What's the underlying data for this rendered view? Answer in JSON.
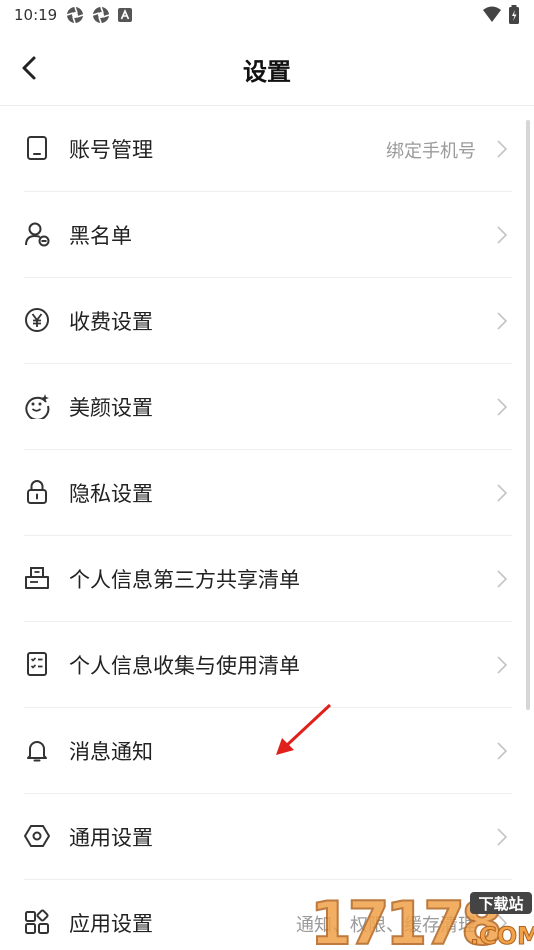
{
  "status_bar": {
    "time": "10:19",
    "icons": [
      "aperture-icon",
      "aperture-icon",
      "a-box-icon"
    ],
    "right_icons": [
      "wifi-icon",
      "battery-charging-icon"
    ]
  },
  "header": {
    "title": "设置",
    "back_icon": "chevron-left-icon"
  },
  "items": [
    {
      "label": "账号管理",
      "value": "绑定手机号",
      "icon": "phone-icon"
    },
    {
      "label": "黑名单",
      "value": "",
      "icon": "user-block-icon"
    },
    {
      "label": "收费设置",
      "value": "",
      "icon": "yen-icon"
    },
    {
      "label": "美颜设置",
      "value": "",
      "icon": "face-sparkle-icon"
    },
    {
      "label": "隐私设置",
      "value": "",
      "icon": "lock-icon"
    },
    {
      "label": "个人信息第三方共享清单",
      "value": "",
      "icon": "share-doc-icon"
    },
    {
      "label": "个人信息收集与使用清单",
      "value": "",
      "icon": "checklist-icon"
    },
    {
      "label": "消息通知",
      "value": "",
      "icon": "bell-icon"
    },
    {
      "label": "通用设置",
      "value": "",
      "icon": "hexagon-gear-icon"
    },
    {
      "label": "应用设置",
      "value": "通知、权限、缓存清理",
      "icon": "apps-grid-icon"
    }
  ],
  "colors": {
    "annotation_arrow": "#e0211b",
    "divider": "#eeeeee",
    "secondary_text": "#9a9a9a"
  },
  "watermark": {
    "text": "17178",
    "badge": "下载站",
    "suffix": ".COM"
  }
}
